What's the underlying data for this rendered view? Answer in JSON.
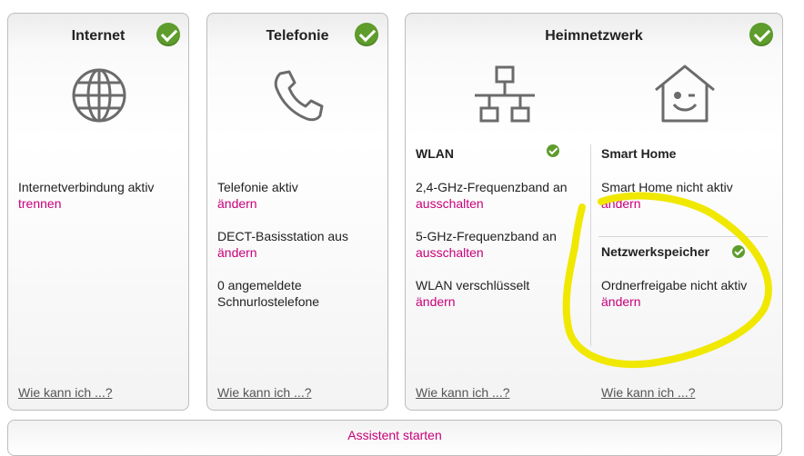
{
  "colors": {
    "accent": "#c7007a",
    "ok": "#5e9c2c",
    "annotation": "#f0e800"
  },
  "internet": {
    "title": "Internet",
    "status": "Internetverbindung aktiv",
    "action": "trennen",
    "help": "Wie kann ich ...?"
  },
  "telefonie": {
    "title": "Telefonie",
    "status1": "Telefonie aktiv",
    "action1": "ändern",
    "status2": "DECT-Basisstation aus",
    "action2": "ändern",
    "status3_line1": "0 angemeldete",
    "status3_line2": "Schnurlostelefone",
    "help": "Wie kann ich ...?"
  },
  "heimnetzwerk": {
    "title": "Heimnetzwerk",
    "wlan": {
      "title": "WLAN",
      "band24": "2,4-GHz-Frequenzband an",
      "band24_action": "ausschalten",
      "band5": "5-GHz-Frequenzband an",
      "band5_action": "ausschalten",
      "encryption": "WLAN verschlüsselt",
      "encryption_action": "ändern",
      "help": "Wie kann ich ...?"
    },
    "smarthome": {
      "title": "Smart Home",
      "status": "Smart Home nicht aktiv",
      "action": "ändern"
    },
    "storage": {
      "title": "Netzwerkspeicher",
      "status": "Ordnerfreigabe nicht aktiv",
      "action": "ändern",
      "help": "Wie kann ich ...?"
    }
  },
  "footer": {
    "assistant": "Assistent starten"
  }
}
